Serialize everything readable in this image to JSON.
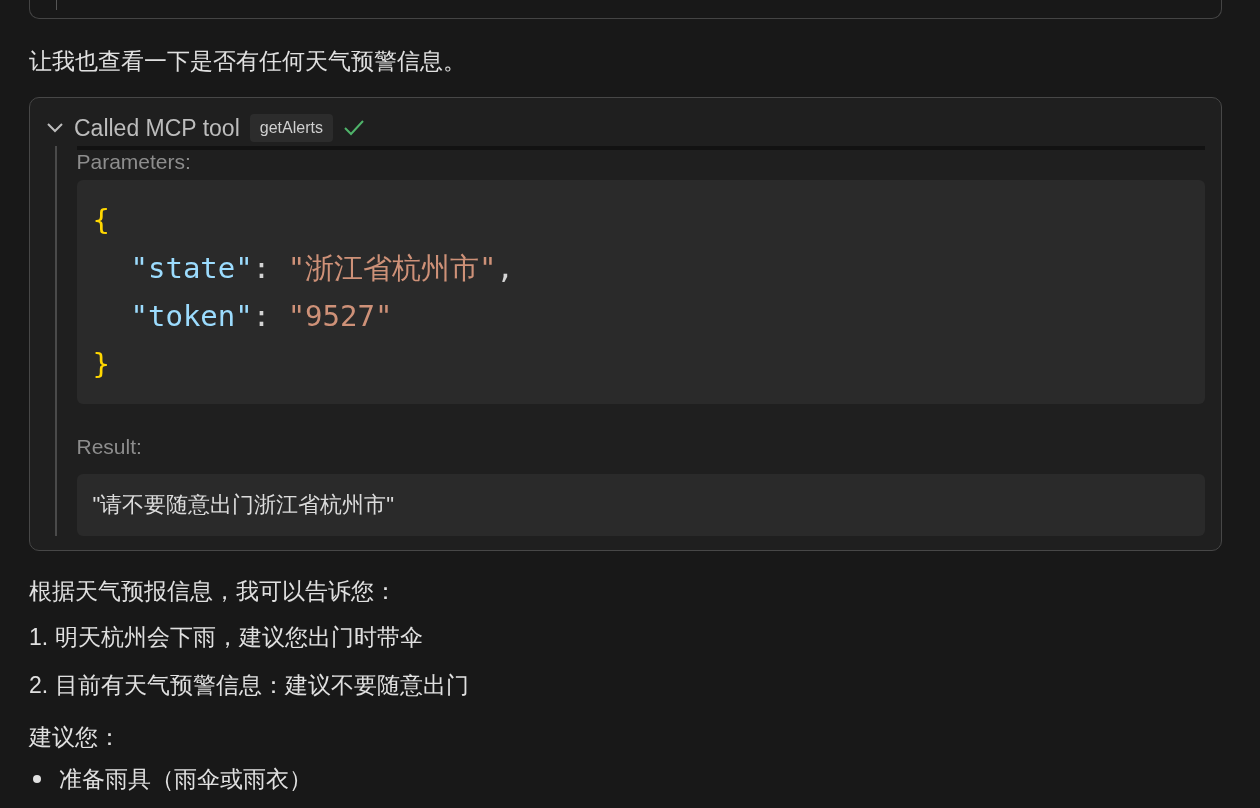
{
  "intro": "让我也查看一下是否有任何天气预警信息。",
  "tool_call": {
    "expanded": true,
    "label": "Called MCP tool",
    "tool_name": "getAlerts",
    "success": true,
    "parameters_label": "Parameters:",
    "open_brace": "{",
    "parameters": [
      {
        "key": "\"state\"",
        "colon": ":",
        "value": "\"浙江省杭州市\"",
        "punct": ","
      },
      {
        "key": "\"token\"",
        "colon": ":",
        "value": "\"9527\""
      }
    ],
    "close_brace": "}",
    "result_label": "Result:",
    "result": "\"请不要随意出门浙江省杭州市\""
  },
  "summary": "根据天气预报信息，我可以告诉您：",
  "numbered": [
    {
      "number": "1.",
      "text": "明天杭州会下雨，建议您出门时带伞"
    },
    {
      "number": "2.",
      "text": "目前有天气预警信息：建议不要随意出门"
    }
  ],
  "advice_label": "建议您：",
  "bullets": [
    "准备雨具（雨伞或雨衣）"
  ]
}
